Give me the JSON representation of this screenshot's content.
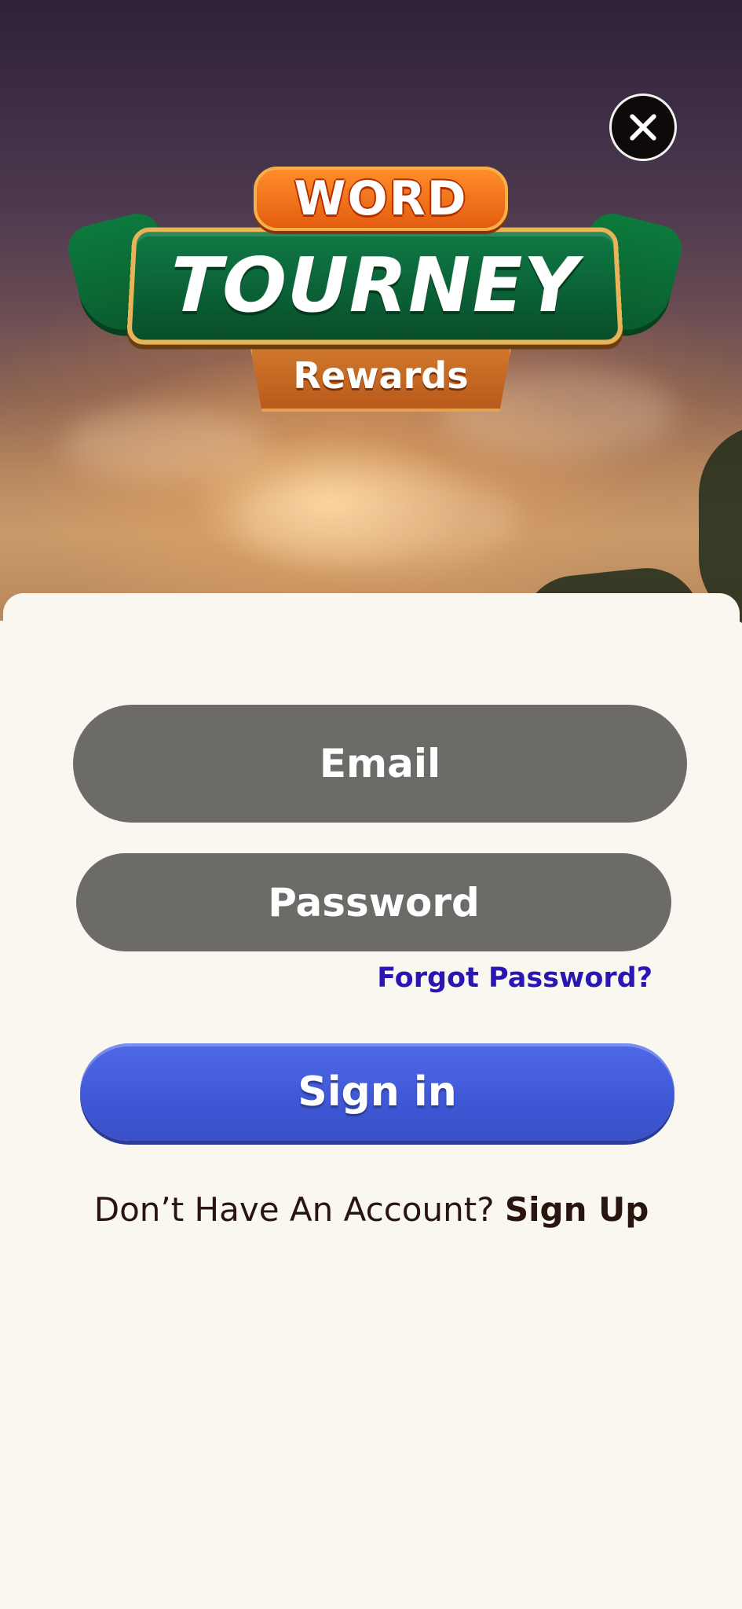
{
  "logo": {
    "word": "WORD",
    "main": "TOURNEY",
    "sub": "Rewards"
  },
  "close": {
    "icon": "close-icon"
  },
  "form": {
    "email_placeholder": "Email",
    "password_placeholder": "Password",
    "forgot_password": "Forgot Password?",
    "sign_in": "Sign in",
    "no_account_text": "Don’t Have An Account?",
    "sign_up": "Sign Up"
  },
  "colors": {
    "field_bg": "#6c6b67",
    "signin_bg": "#3f57d6",
    "link": "#2a16b3",
    "card_bg": "#f9f7ef"
  }
}
